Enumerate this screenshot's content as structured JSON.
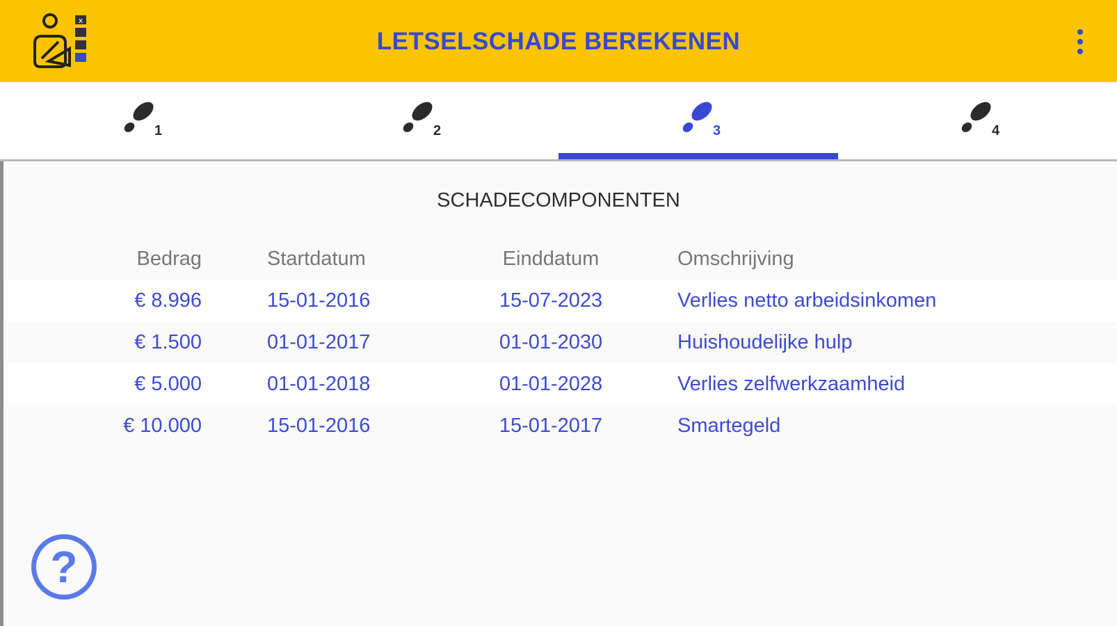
{
  "appbar": {
    "title": "LETSELSCHADE BEREKENEN",
    "logo_icon": "injured-person-checklist-icon",
    "menu_icon": "more-vert-icon",
    "background_color": "#fbc400",
    "accent_color": "#3848d2"
  },
  "tabs": [
    {
      "label": "1",
      "icon": "footprint-icon",
      "active": false
    },
    {
      "label": "2",
      "icon": "footprint-icon",
      "active": false
    },
    {
      "label": "3",
      "icon": "footprint-icon",
      "active": true
    },
    {
      "label": "4",
      "icon": "footprint-icon",
      "active": false
    }
  ],
  "section": {
    "title": "SCHADECOMPONENTEN"
  },
  "table": {
    "columns": [
      "Bedrag",
      "Startdatum",
      "Einddatum",
      "Omschrijving"
    ],
    "rows": [
      {
        "amount": "€ 8.996",
        "start": "15-01-2016",
        "end": "15-07-2023",
        "description": "Verlies netto arbeidsinkomen"
      },
      {
        "amount": "€ 1.500",
        "start": "01-01-2017",
        "end": "01-01-2030",
        "description": "Huishoudelijke hulp"
      },
      {
        "amount": "€ 5.000",
        "start": "01-01-2018",
        "end": "01-01-2028",
        "description": "Verlies zelfwerkzaamheid"
      },
      {
        "amount": "€ 10.000",
        "start": "15-01-2016",
        "end": "15-01-2017",
        "description": "Smartegeld"
      }
    ]
  },
  "help": {
    "label": "?",
    "icon": "help-circle-icon"
  }
}
